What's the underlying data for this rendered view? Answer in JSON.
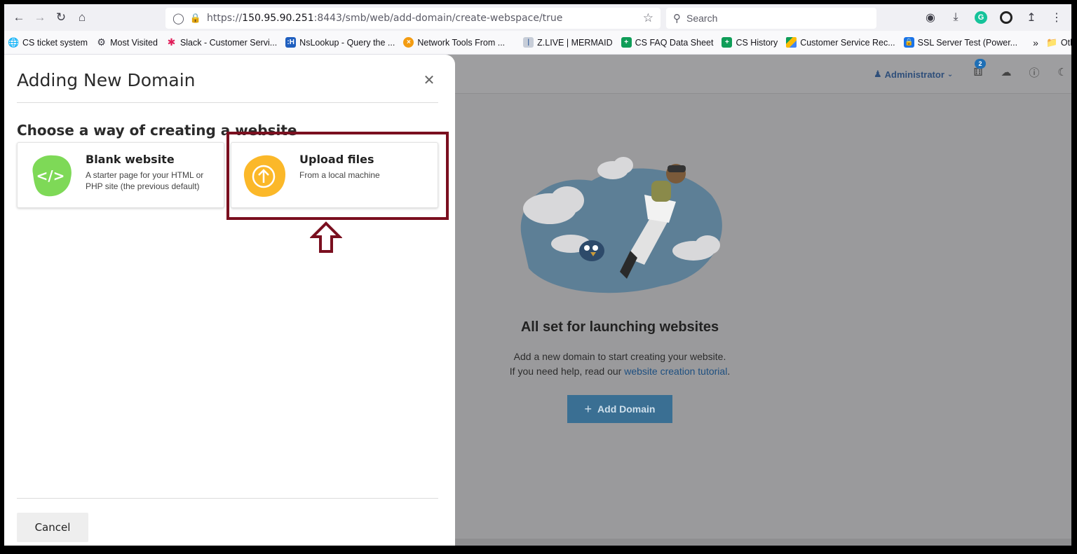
{
  "browser": {
    "url_scheme": "https://",
    "url_host": "150.95.90.251",
    "url_rest": ":8443/smb/web/add-domain/create-webspace/true",
    "search_placeholder": "Search",
    "bookmarks": [
      {
        "label": "CS ticket system",
        "icon": "globe-icon",
        "color": "#3b3b45"
      },
      {
        "label": "Most Visited",
        "icon": "gear-icon",
        "color": "#3b3b45"
      },
      {
        "label": "Slack - Customer Servi...",
        "icon": "slack-icon",
        "color": "#e01e5a"
      },
      {
        "label": "NsLookup - Query the ...",
        "icon": "nslookup-icon",
        "color": "#1f5fbf"
      },
      {
        "label": "Network Tools From ...",
        "icon": "network-tools-icon",
        "color": "#f39c12"
      },
      {
        "label": "Z.LIVE | MERMAID",
        "icon": "zlive-icon",
        "color": "#9aa3b5"
      },
      {
        "label": "CS FAQ Data Sheet",
        "icon": "sheets-icon",
        "color": "#0f9d58"
      },
      {
        "label": "CS History",
        "icon": "sheets-icon",
        "color": "#0f9d58"
      },
      {
        "label": "Customer Service Rec...",
        "icon": "drive-icon",
        "color": "#fbbc04"
      },
      {
        "label": "SSL Server Test (Power...",
        "icon": "ssl-icon",
        "color": "#1a73e8"
      }
    ],
    "other_bookmarks": "Other Bookma"
  },
  "app": {
    "user_label": "Administrator",
    "notification_count": "2",
    "empty_title": "All set for launching websites",
    "empty_line1": "Add a new domain to start creating your website.",
    "empty_line2_prefix": "If you need help, read our ",
    "empty_link": "website creation tutorial",
    "empty_line2_suffix": ".",
    "add_domain_label": "Add Domain"
  },
  "modal": {
    "title": "Adding New Domain",
    "section_title": "Choose a way of creating a website",
    "cards": [
      {
        "title": "Blank website",
        "description": "A starter page for your HTML or PHP site (the previous default)",
        "icon": "code-icon",
        "color": "#7ed957"
      },
      {
        "title": "Upload files",
        "description": "From a local machine",
        "icon": "upload-icon",
        "color": "#fbb829"
      }
    ],
    "cancel_label": "Cancel"
  },
  "annotation": {
    "highlight_color": "#7a0f1f"
  }
}
